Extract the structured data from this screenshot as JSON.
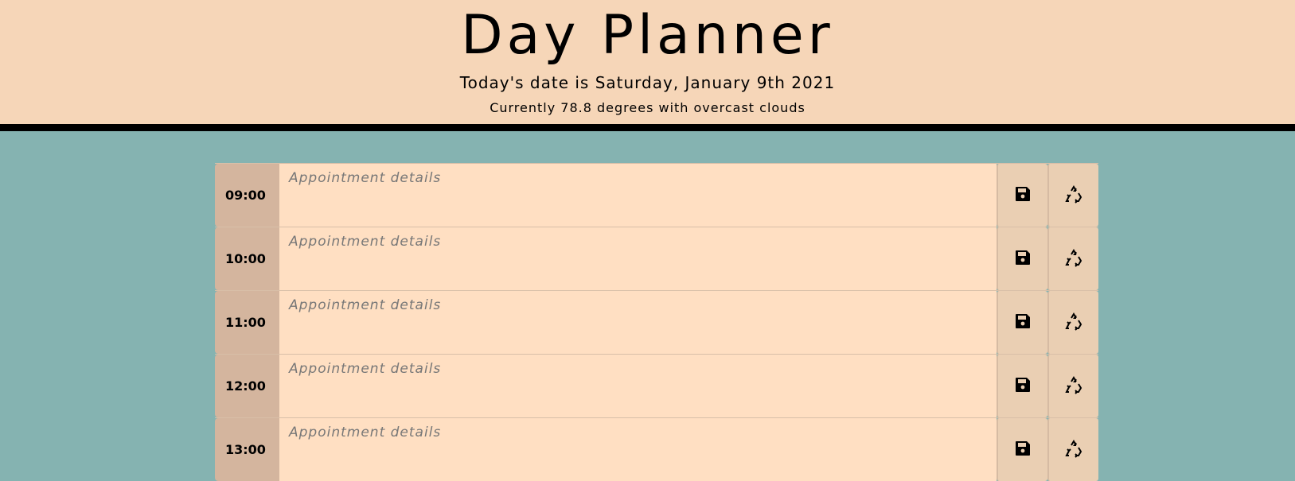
{
  "header": {
    "title": "Day Planner",
    "date": "Today's date is Saturday, January 9th 2021",
    "weather": "Currently 78.8 degrees with overcast clouds"
  },
  "rows": [
    {
      "time": "09:00",
      "placeholder": "Appointment details"
    },
    {
      "time": "10:00",
      "placeholder": "Appointment details"
    },
    {
      "time": "11:00",
      "placeholder": "Appointment details"
    },
    {
      "time": "12:00",
      "placeholder": "Appointment details"
    },
    {
      "time": "13:00",
      "placeholder": "Appointment details"
    }
  ]
}
